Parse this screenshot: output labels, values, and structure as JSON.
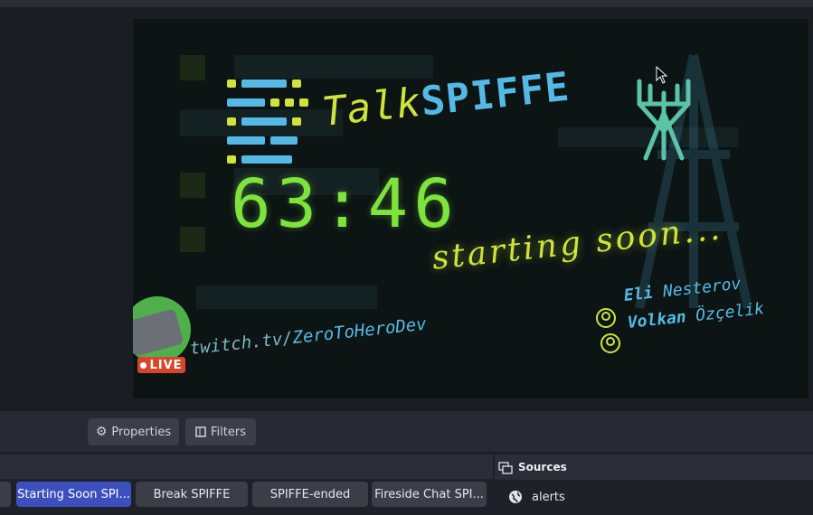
{
  "stream": {
    "title_left": "Talk",
    "title_right": "SPIFFE",
    "timer": "63:46",
    "status": "starting soon...",
    "url_prefix": "twitch.tv/",
    "url_channel": "ZeroToHeroDev",
    "live_badge": "LIVE",
    "host1_first": "Eli",
    "host1_last": "Nesterov",
    "host2_first": "Volkan",
    "host2_last": "Özçelik"
  },
  "toolbar": {
    "properties_label": "Properties",
    "filters_label": "Filters"
  },
  "scenes": [
    {
      "label": "Starting Soon SPI...",
      "active": true
    },
    {
      "label": "Break SPIFFE",
      "active": false
    },
    {
      "label": "SPIFFE-ended",
      "active": false
    },
    {
      "label": "Fireside Chat SPI...",
      "active": false
    }
  ],
  "sources": {
    "title": "Sources",
    "items": [
      {
        "label": "alerts",
        "icon": "globe-icon"
      }
    ]
  },
  "colors": {
    "accent": "#3c4fbe",
    "lime": "#cfe33a",
    "sky": "#55b9e6",
    "green": "#7fe33d",
    "live": "#d9452b"
  }
}
